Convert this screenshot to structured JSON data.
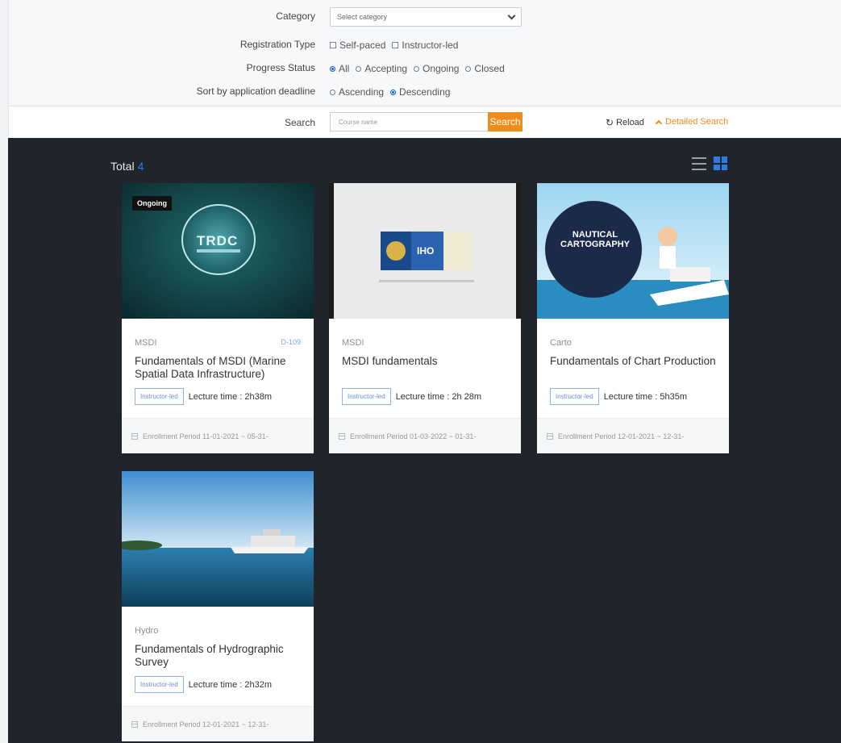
{
  "filters": {
    "category": {
      "label": "Category",
      "placeholder": "Select category"
    },
    "registration_type": {
      "label": "Registration Type",
      "options": [
        "Self-paced",
        "Instructor-led"
      ]
    },
    "progress_status": {
      "label": "Progress Status",
      "options": [
        "All",
        "Accepting",
        "Ongoing",
        "Closed"
      ],
      "selected": "All"
    },
    "sort": {
      "label": "Sort by application deadline",
      "options": [
        "Ascending",
        "Descending"
      ],
      "selected": "Descending"
    },
    "search": {
      "label": "Search",
      "placeholder": "Course name",
      "button": "Search"
    },
    "reload": "Reload",
    "detailed_search": "Detailed Search"
  },
  "results": {
    "total_label": "Total",
    "total_count": "4"
  },
  "courses": [
    {
      "status": "Ongoing",
      "category": "MSDI",
      "code": "D-109",
      "title": "Fundamentals of MSDI (Marine Spatial Data Infrastructure)",
      "badge": "Instructor-led",
      "lecture_time": "Lecture time : 2h38m",
      "enrollment": "Enrollment Period 11-01-2021 ~ 05-31-",
      "thumb_text": "TRDC"
    },
    {
      "category": "MSDI",
      "title": "MSDI fundamentals",
      "badge": "Instructor-led",
      "lecture_time": "Lecture time : 2h 28m",
      "enrollment": "Enrollment Period 01-03-2022 ~ 01-31-",
      "thumb_text": "IHO"
    },
    {
      "category": "Carto",
      "title": "Fundamentals of Chart Production",
      "badge": "Instructor-led",
      "lecture_time": "Lecture time : 5h35m",
      "enrollment": "Enrollment Period 12-01-2021 ~ 12-31-",
      "thumb_text": "NAUTICAL CARTOGRAPHY"
    },
    {
      "category": "Hydro",
      "title": "Fundamentals of Hydrographic Survey",
      "badge": "Instructor-led",
      "lecture_time": "Lecture time : 2h32m",
      "enrollment": "Enrollment Period 12-01-2021 ~ 12-31-"
    }
  ],
  "colors": {
    "accent": "#ef8c1b",
    "blue": "#2f7be0",
    "dark_bg": "#20242b"
  }
}
